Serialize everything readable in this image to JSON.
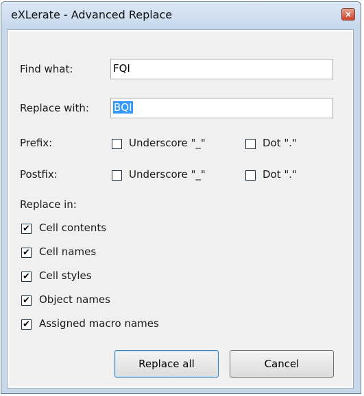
{
  "window": {
    "title": "eXLerate - Advanced Replace",
    "close_label": "×"
  },
  "find": {
    "label": "Find what:",
    "value": "FQI"
  },
  "replace": {
    "label": "Replace with:",
    "value": "BQI"
  },
  "prefix": {
    "label": "Prefix:",
    "underscore": {
      "label": "Underscore \"_\"",
      "checked": false
    },
    "dot": {
      "label": "Dot \".\"",
      "checked": false
    }
  },
  "postfix": {
    "label": "Postfix:",
    "underscore": {
      "label": "Underscore \"_\"",
      "checked": false
    },
    "dot": {
      "label": "Dot \".\"",
      "checked": false
    }
  },
  "replace_in": {
    "label": "Replace in:",
    "options": [
      {
        "label": "Cell contents",
        "checked": true
      },
      {
        "label": "Cell names",
        "checked": true
      },
      {
        "label": "Cell styles",
        "checked": true
      },
      {
        "label": "Object names",
        "checked": true
      },
      {
        "label": "Assigned macro names",
        "checked": true
      }
    ]
  },
  "buttons": {
    "replace_all": "Replace all",
    "cancel": "Cancel"
  },
  "check_glyph": "✔"
}
